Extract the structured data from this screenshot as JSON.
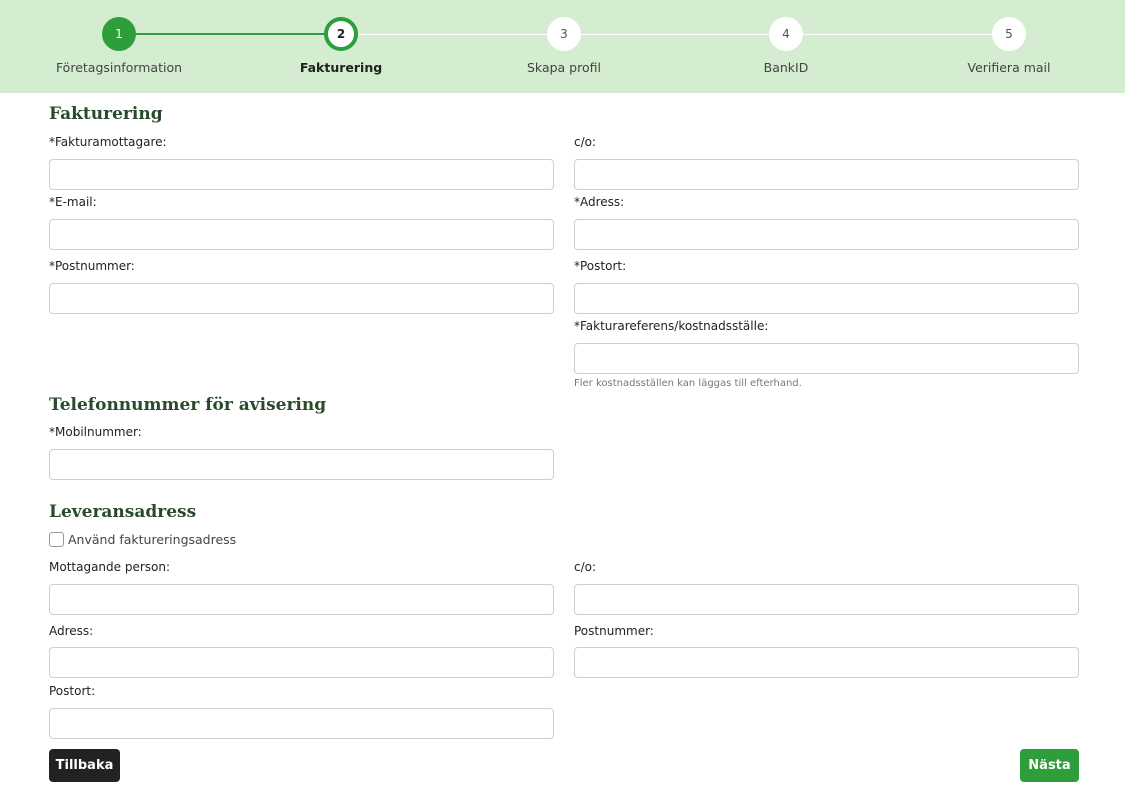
{
  "stepper": {
    "steps": [
      {
        "number": "1",
        "label": "Företagsinformation",
        "state": "done"
      },
      {
        "number": "2",
        "label": "Fakturering",
        "state": "active"
      },
      {
        "number": "3",
        "label": "Skapa profil",
        "state": "pending"
      },
      {
        "number": "4",
        "label": "BankID",
        "state": "pending"
      },
      {
        "number": "5",
        "label": "Verifiera mail",
        "state": "pending"
      }
    ]
  },
  "billing": {
    "title": "Fakturering",
    "recipient_label": "*Fakturamottagare:",
    "co_label": "c/o:",
    "email_label": "*E-mail:",
    "address_label": "*Adress:",
    "postcode_label": "*Postnummer:",
    "city_label": "*Postort:",
    "reference_label": "*Fakturareferens/kostnadsställe:",
    "reference_hint": "Fler kostnadsställen kan läggas till efterhand."
  },
  "phone": {
    "title": "Telefonnummer för avisering",
    "mobile_label": "*Mobilnummer:"
  },
  "delivery": {
    "title": "Leveransadress",
    "use_billing_label": "Använd faktureringsadress",
    "use_billing_checked": false,
    "recipient_label": "Mottagande person:",
    "co_label": "c/o:",
    "address_label": "Adress:",
    "postcode_label": "Postnummer:",
    "city_label": "Postort:"
  },
  "actions": {
    "back_label": "Tillbaka",
    "next_label": "Nästa"
  },
  "colors": {
    "accent": "#2e9e3a",
    "stepper_bg": "#d4ecd0",
    "heading": "#2a4a2c"
  }
}
